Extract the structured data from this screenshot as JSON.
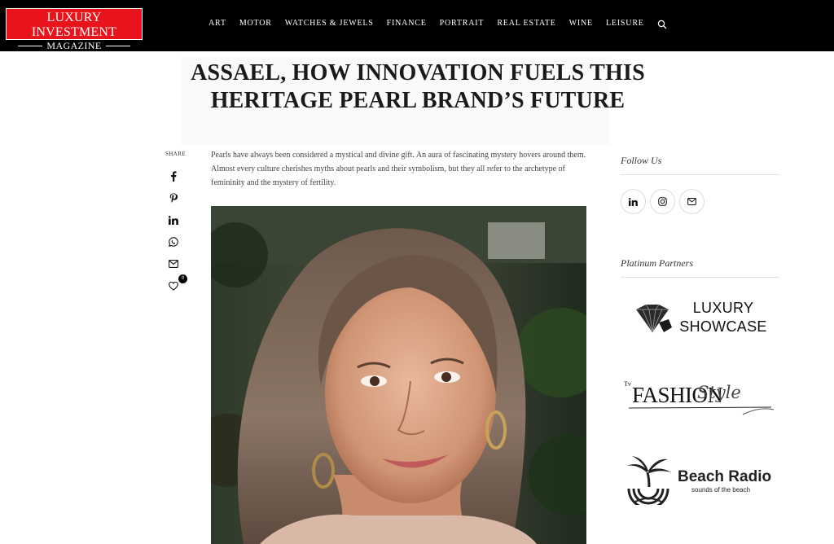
{
  "logo": {
    "line1": "LUXURY INVESTMENT",
    "line2": "MAGAZINE"
  },
  "nav": {
    "items": [
      "ART",
      "MOTOR",
      "WATCHES & JEWELS",
      "FINANCE",
      "PORTRAIT",
      "REAL ESTATE",
      "WINE",
      "LEISURE"
    ],
    "search_icon": "search-icon"
  },
  "article": {
    "title": "ASSAEL, HOW INNOVATION FUELS THIS HERITAGE PEARL BRAND’S FUTURE",
    "intro": "Pearls have always been considered a mystical and divine gift. An aura of fascinating mystery hovers around them. Almost every culture cherishes myths about pearls and their symbolism, but they all refer to the archetype of femininity and the mystery of fertility."
  },
  "share": {
    "label": "SHARE",
    "icons": [
      "facebook-icon",
      "pinterest-icon",
      "linkedin-icon",
      "whatsapp-icon",
      "email-icon",
      "heart-icon"
    ],
    "like_count": "0"
  },
  "sidebar": {
    "follow_heading": "Follow Us",
    "follow_icons": [
      "linkedin-icon",
      "instagram-icon",
      "email-icon"
    ],
    "partners_heading": "Platinum Partners",
    "partners": {
      "luxury_showcase": {
        "line1": "LUXURY",
        "line2": "SHOWCASE"
      },
      "fashion_style": {
        "tv": "Tv",
        "main": "FASHION",
        "script": "Style"
      },
      "beach_radio": {
        "title": "Beach Radio",
        "subtitle": "sounds of the beach"
      }
    }
  },
  "colors": {
    "header_bg": "#000000",
    "logo_bg": "#e8131b",
    "text": "#222222"
  }
}
